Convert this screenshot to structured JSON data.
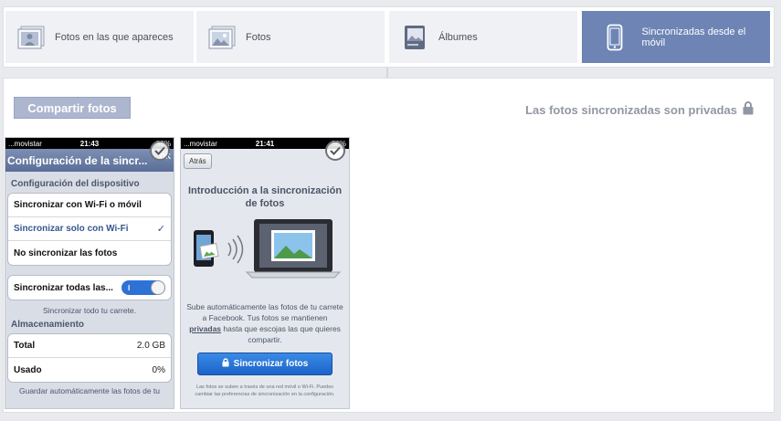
{
  "tabs": [
    {
      "label": "Fotos en las que apareces",
      "icon": "person-photo-icon",
      "active": false
    },
    {
      "label": "Fotos",
      "icon": "photos-icon",
      "active": false
    },
    {
      "label": "Álbumes",
      "icon": "album-icon",
      "active": false
    },
    {
      "label": "Sincronizadas desde el móvil",
      "icon": "mobile-phone-icon",
      "active": true
    }
  ],
  "toolbar": {
    "share_label": "Compartir fotos",
    "private_note": "Las fotos sincronizadas son privadas",
    "private_icon": "lock-icon"
  },
  "phone1": {
    "carrier": "...movistar",
    "time": "21:43",
    "battery": "58%",
    "nav_title": "Configuración de la sincr...",
    "nav_ok": "OK",
    "section_device": "Configuración del dispositivo",
    "options": [
      {
        "label": "Sincronizar con Wi-Fi o móvil",
        "selected": false
      },
      {
        "label": "Sincronizar solo con Wi-Fi",
        "selected": true
      },
      {
        "label": "No sincronizar las fotos",
        "selected": false
      }
    ],
    "sync_all_label": "Sincronizar todas las...",
    "sync_all_toggle": "I",
    "sync_all_note": "Sincronizar todo tu carrete.",
    "section_storage": "Almacenamiento",
    "storage": [
      {
        "label": "Total",
        "value": "2.0 GB"
      },
      {
        "label": "Usado",
        "value": "0%"
      }
    ],
    "footer_note": "Guardar automáticamente las fotos de tu"
  },
  "phone2": {
    "carrier": "...movistar",
    "time": "21:41",
    "battery": "58%",
    "back_label": "Atrás",
    "title": "Introducción a la sincronización de fotos",
    "desc_1": "Sube automáticamente las fotos de tu carrete a Facebook. Tus fotos se mantienen",
    "desc_bold": "privadas",
    "desc_2": "hasta que escojas las que quieres compartir.",
    "button_label": "Sincronizar fotos",
    "fine_print": "Las fotos se suben a través de una red móvil o Wi-Fi. Puedes cambiar las preferencias de sincronización en la configuración."
  },
  "colors": {
    "active_tab": "#6d84b4",
    "share_button": "#adb6cf",
    "sync_button": "#1b63c9"
  }
}
